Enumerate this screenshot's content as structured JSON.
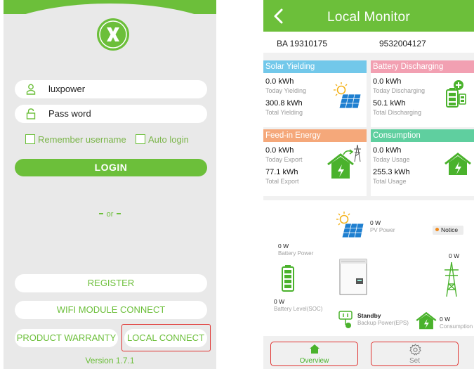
{
  "login": {
    "username_value": "luxpower",
    "password_placeholder": "Pass word",
    "remember_label": "Remember username",
    "auto_login_label": "Auto login",
    "login_button": "LOGIN",
    "or_text": "or",
    "register_button": "REGISTER",
    "wifi_button": "WIFI MODULE CONNECT",
    "warranty_button": "PRODUCT WARRANTY",
    "local_connect_button": "LOCAL CONNECT",
    "version": "Version 1.7.1",
    "colors": {
      "brand": "#6cbf3a",
      "highlight": "#e0322f"
    },
    "icons": {
      "logo": "x-logo-icon",
      "user": "user-icon",
      "lock": "lock-icon"
    }
  },
  "monitor": {
    "title": "Local Monitor",
    "serial_1": "BA 19310175",
    "serial_2": "9532004127",
    "cards": {
      "solar": {
        "title": "Solar Yielding",
        "today_value": "0.0 kWh",
        "today_label": "Today Yielding",
        "total_value": "300.8  kWh",
        "total_label": "Total Yielding",
        "color": "#72c8ea"
      },
      "battery": {
        "title": "Battery Discharging",
        "today_value": "0.0 kWh",
        "today_label": "Today Discharging",
        "total_value": "50.1  kWh",
        "total_label": "Total Discharging",
        "color": "#f2a0b2"
      },
      "feedin": {
        "title": "Feed-in Energy",
        "today_value": "0.0 kWh",
        "today_label": "Today Export",
        "total_value": "77.1  kWh",
        "total_label": "Total Export",
        "color": "#f5a87a"
      },
      "consumption": {
        "title": "Consumption",
        "today_value": "0.0 kWh",
        "today_label": "Today Usage",
        "total_value": "255.3  kWh",
        "total_label": "Total Usage",
        "color": "#5fcf9f"
      }
    },
    "flow": {
      "pv_value": "0 W",
      "pv_label": "PV Power",
      "battery_value": "0 W",
      "battery_label": "Battery Power",
      "soc_value": "0 W",
      "soc_label": "Battery  Level(SOC)",
      "grid_value": "0 W",
      "standby_label": "Standby",
      "eps_label": "Backup Power(EPS)",
      "consumption_value": "0 W",
      "consumption_label": "Consumption",
      "notice_label": "Notice"
    },
    "tabs": {
      "overview": "Overview",
      "set": "Set"
    },
    "icons": [
      "back-arrow-icon",
      "solar-panel-icon",
      "battery-icon",
      "house-grid-icon",
      "house-icon",
      "inverter-icon",
      "pylon-icon",
      "eps-plug-icon",
      "gear-icon"
    ]
  }
}
